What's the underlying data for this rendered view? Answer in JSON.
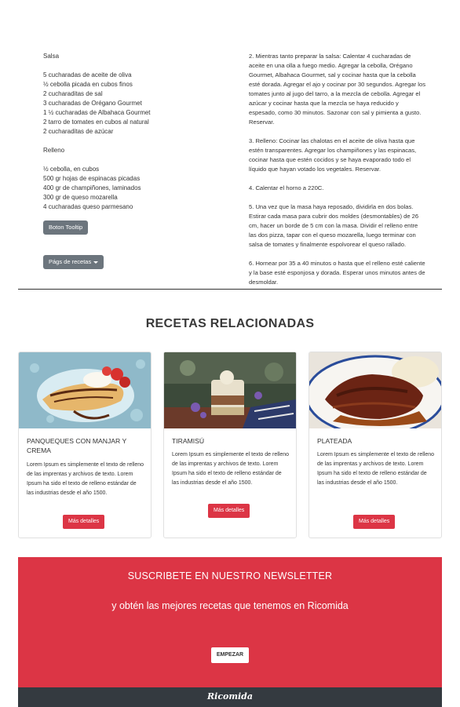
{
  "recipe": {
    "salsa_heading": "Salsa",
    "salsa_items": [
      "5 cucharadas de aceite de oliva",
      "½ cebolla picada en cubos finos",
      "2 cucharaditas de sal",
      "3 cucharadas de Orégano Gourmet",
      "1 ½ cucharadas de Albahaca Gourmet",
      "2 tarro de tomates en cubos al natural",
      "2 cucharaditas de azúcar"
    ],
    "relleno_heading": "Relleno",
    "relleno_items": [
      "½ cebolla, en cubos",
      "500 gr hojas de espinacas picadas",
      "400 gr de champiñones, laminados",
      "300 gr de queso mozarella",
      "4 cucharadas queso parmesano"
    ],
    "tooltip_button": "Boton Tooltip",
    "dropdown_button": "Págs de recetas",
    "steps": [
      "2. Mientras tanto preparar la salsa: Calentar 4 cucharadas de aceite en una olla a fuego medio. Agregar la cebolla, Orégano Gourmet, Albahaca Gourmet, sal y cocinar hasta que la cebolla esté dorada. Agregar el ajo y cocinar por 30 segundos. Agregar los tomates junto al jugo del tarro, a la mezcla de cebolla. Agregar el azúcar y cocinar hasta que la mezcla se haya reducido y espesado, como 30 minutos. Sazonar con sal y pimienta a gusto. Reservar.",
      "3. Relleno: Cocinar las chalotas en el aceite de oliva hasta que estén transparentes. Agregar los champiñones y las espinacas, cocinar hasta que estén cocidos y se haya evaporado todo el líquido que hayan votado los vegetales. Reservar.",
      "4. Calentar el horno a 220C.",
      "5. Una vez que la masa haya reposado, dividirla en dos bolas. Estirar cada masa para cubrir dos moldes (desmontables) de 26 cm, hacer un borde de 5 cm con la masa. Dividir el relleno entre las dos pizza, tapar con el queso mozarella, luego terminar con salsa de tomates y finalmente espolvorear el queso rallado.",
      "6. Hornear por 35 a 40 minutos o hasta que el relleno esté caliente y la base esté esponjosa y dorada. Esperar unos minutos antes de desmoldar."
    ]
  },
  "related": {
    "title": "RECETAS RELACIONADAS",
    "cards": [
      {
        "title": "PANQUEQUES CON MANJAR Y CREMA",
        "text": "Lorem Ipsum es simplemente el texto de relleno de las imprentas y archivos de texto. Lorem Ipsum ha sido el texto de relleno estándar de las industrias desde el año 1500.",
        "button": "Más detalles"
      },
      {
        "title": "TIRAMISÚ",
        "text": "Lorem Ipsum es simplemente el texto de relleno de las imprentas y archivos de texto. Lorem Ipsum ha sido el texto de relleno estándar de las industrias desde el año 1500.",
        "button": "Más detalles"
      },
      {
        "title": "PLATEADA",
        "text": "Lorem Ipsum es simplemente el texto de relleno de las imprentas y archivos de texto. Lorem Ipsum ha sido el texto de relleno estándar de las industrias desde el año 1500.",
        "button": "Más detalles"
      }
    ]
  },
  "newsletter": {
    "title": "SUSCRIBETE EN NUESTRO NEWSLETTER",
    "subtitle": "y obtén las mejores recetas que tenemos en Ricomida",
    "button": "EMPEZAR"
  },
  "footer": {
    "logo": "Ricomida"
  },
  "colors": {
    "accent": "#dc3545",
    "footer": "#343a40",
    "secondary_button": "#6c757d"
  }
}
